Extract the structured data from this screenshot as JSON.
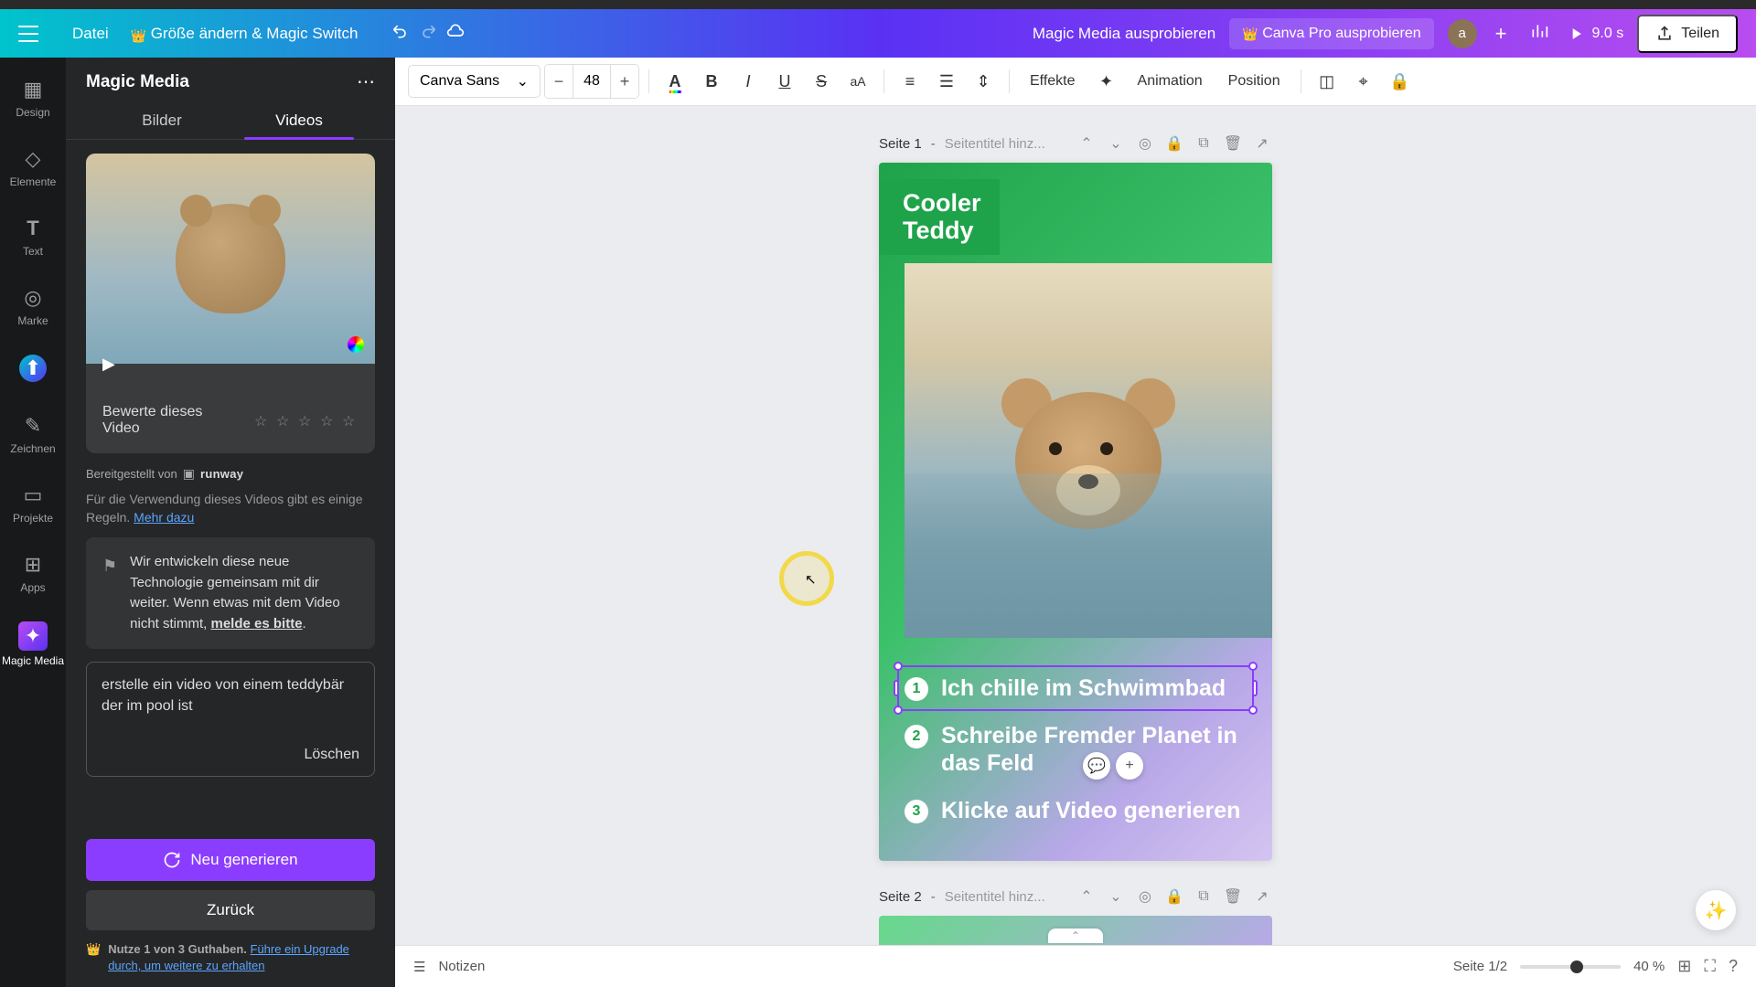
{
  "header": {
    "file": "Datei",
    "resize": "Größe ändern & Magic Switch",
    "try_magic": "Magic Media ausprobieren",
    "try_pro": "Canva Pro ausprobieren",
    "avatar": "a",
    "duration": "9.0 s",
    "share": "Teilen"
  },
  "rail": {
    "design": "Design",
    "elements": "Elemente",
    "text": "Text",
    "brand": "Marke",
    "uploads": "",
    "draw": "Zeichnen",
    "projects": "Projekte",
    "apps": "Apps",
    "magic_media": "Magic Media"
  },
  "panel": {
    "title": "Magic Media",
    "tab_images": "Bilder",
    "tab_videos": "Videos",
    "rate_label": "Bewerte dieses Video",
    "provided_by": "Bereitgestellt von",
    "provider": "runway",
    "rules_text": "Für die Verwendung dieses Videos gibt es einige Regeln. ",
    "rules_link": "Mehr dazu",
    "dev_text_1": "Wir entwickeln diese neue Technologie gemeinsam mit dir weiter. Wenn etwas mit dem Video nicht stimmt, ",
    "dev_text_2": "melde es bitte",
    "prompt": "erstelle ein video von einem teddybär der im pool ist",
    "clear": "Löschen",
    "generate": "Neu generieren",
    "back": "Zurück",
    "credits_bold": "Nutze 1 von 3 Guthaben.",
    "credits_link": "Führe ein Upgrade durch, um weitere zu erhalten"
  },
  "toolbar": {
    "font": "Canva Sans",
    "size": "48",
    "effects": "Effekte",
    "animation": "Animation",
    "position": "Position"
  },
  "page1": {
    "label": "Seite 1",
    "title_placeholder": "Seitentitel hinz...",
    "heading": "Cooler Teddy",
    "step1": "Ich chille im Schwimmbad",
    "step2_a": "Schreibe ",
    "step2_b": "Fremder Planet",
    "step2_c": " in das Feld",
    "step3_a": "Klicke auf ",
    "step3_b": "Video generieren"
  },
  "page2": {
    "label": "Seite 2",
    "title_placeholder": "Seitentitel hinz..."
  },
  "footer": {
    "notes": "Notizen",
    "page_indicator": "Seite 1/2",
    "zoom": "40 %"
  }
}
